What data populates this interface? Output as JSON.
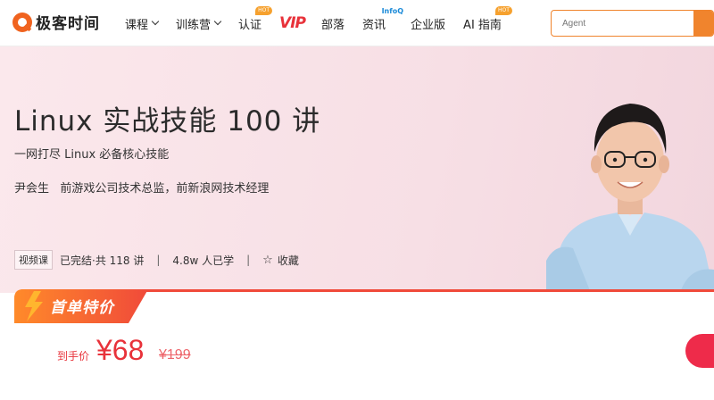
{
  "brand": {
    "name": "极客时间"
  },
  "nav": {
    "items": [
      {
        "label": "课程",
        "dropdown": true
      },
      {
        "label": "训练营",
        "dropdown": true
      },
      {
        "label": "认证",
        "badge": "HOT"
      },
      {
        "label": "VIP"
      },
      {
        "label": "部落"
      },
      {
        "label": "资讯",
        "badge": "InfoQ"
      },
      {
        "label": "企业版"
      },
      {
        "label": "AI 指南",
        "badge": "HOT"
      }
    ]
  },
  "search": {
    "placeholder": "Agent"
  },
  "course": {
    "title": "Linux 实战技能 100 讲",
    "subtitle": "一网打尽 Linux 必备核心技能",
    "author": "尹会生   前游戏公司技术总监，前新浪网技术经理",
    "type_tag": "视频课",
    "status": "已完结·共 118 讲",
    "learners": "4.8w 人已学",
    "favorite_label": "收藏"
  },
  "offer": {
    "badge": "首单特价",
    "price_label": "到手价",
    "price": "¥68",
    "original_price": "¥199"
  },
  "colors": {
    "accent": "#f0842d",
    "price": "#e8323a",
    "hero_bg": "#f7dfe5"
  }
}
